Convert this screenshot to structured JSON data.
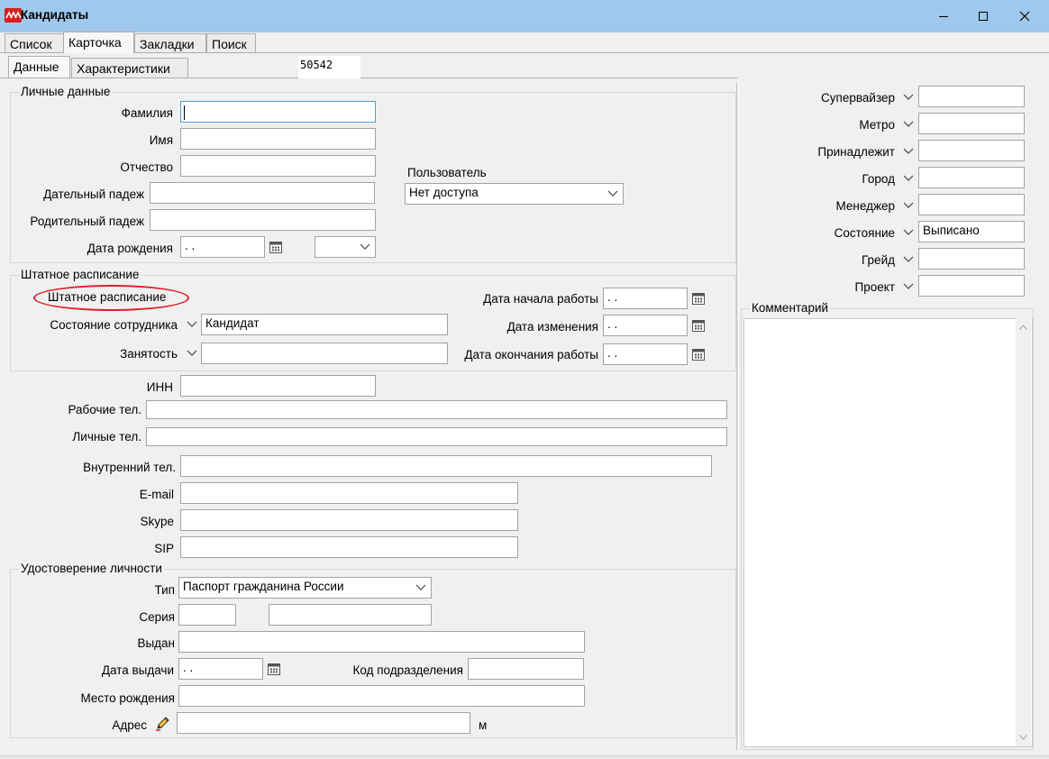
{
  "window": {
    "title": "Кандидаты",
    "icon": "app-logo-icon",
    "buttons": [
      "minimize-icon",
      "maximize-icon",
      "close-icon"
    ]
  },
  "tabs_main": [
    "Список",
    "Карточка",
    "Закладки",
    "Поиск"
  ],
  "tabs_main_active": "Карточка",
  "tabs_sub": [
    "Данные",
    "Характеристики"
  ],
  "tabs_sub_active": "Данные",
  "record_id": "50542",
  "personal": {
    "legend": "Личные данные",
    "lastname_label": "Фамилия",
    "lastname_value": "",
    "firstname_label": "Имя",
    "firstname_value": "",
    "patronymic_label": "Отчество",
    "patronymic_value": "",
    "dative_label": "Дательный падеж",
    "dative_value": "",
    "genitive_label": "Родительный падеж",
    "genitive_value": "",
    "birthdate_label": "Дата рождения",
    "birthdate_value": " .  .",
    "user_label": "Пользователь",
    "user_value": "Нет доступа"
  },
  "staffing": {
    "legend": "Штатное расписание",
    "link_label": "Штатное расписание",
    "status_label": "Состояние сотрудника",
    "status_value": "Кандидат",
    "employment_label": "Занятость",
    "employment_value": "",
    "start_label": "Дата начала работы",
    "start_value": " .  .",
    "change_label": "Дата изменения",
    "change_value": " .  .",
    "end_label": "Дата окончания работы",
    "end_value": " .  ."
  },
  "contacts": {
    "inn_label": "ИНН",
    "work_phone_label": "Рабочие тел.",
    "personal_phone_label": "Личные тел.",
    "internal_phone_label": "Внутренний тел.",
    "email_label": "E-mail",
    "skype_label": "Skype",
    "sip_label": "SIP"
  },
  "identity": {
    "legend": "Удостоверение личности",
    "type_label": "Тип",
    "type_value": "Паспорт гражданина России",
    "series_label": "Серия",
    "issued_label": "Выдан",
    "issue_date_label": "Дата выдачи",
    "issue_date_value": " .  .",
    "dept_code_label": "Код подразделения",
    "birthplace_label": "Место рождения",
    "address_label": "Адрес",
    "address_suffix": "м"
  },
  "right_panel": {
    "supervisor_label": "Супервайзер",
    "metro_label": "Метро",
    "belongs_label": "Принадлежит",
    "city_label": "Город",
    "manager_label": "Менеджер",
    "state_label": "Состояние",
    "state_value": "Выписано",
    "grade_label": "Грейд",
    "project_label": "Проект",
    "comment_legend": "Комментарий"
  },
  "colors": {
    "titlebar": "#9fc8ec",
    "window_bg": "#f0f0f0",
    "annotation_oval": "#e0202a",
    "focus_border": "#5b9bd5"
  }
}
